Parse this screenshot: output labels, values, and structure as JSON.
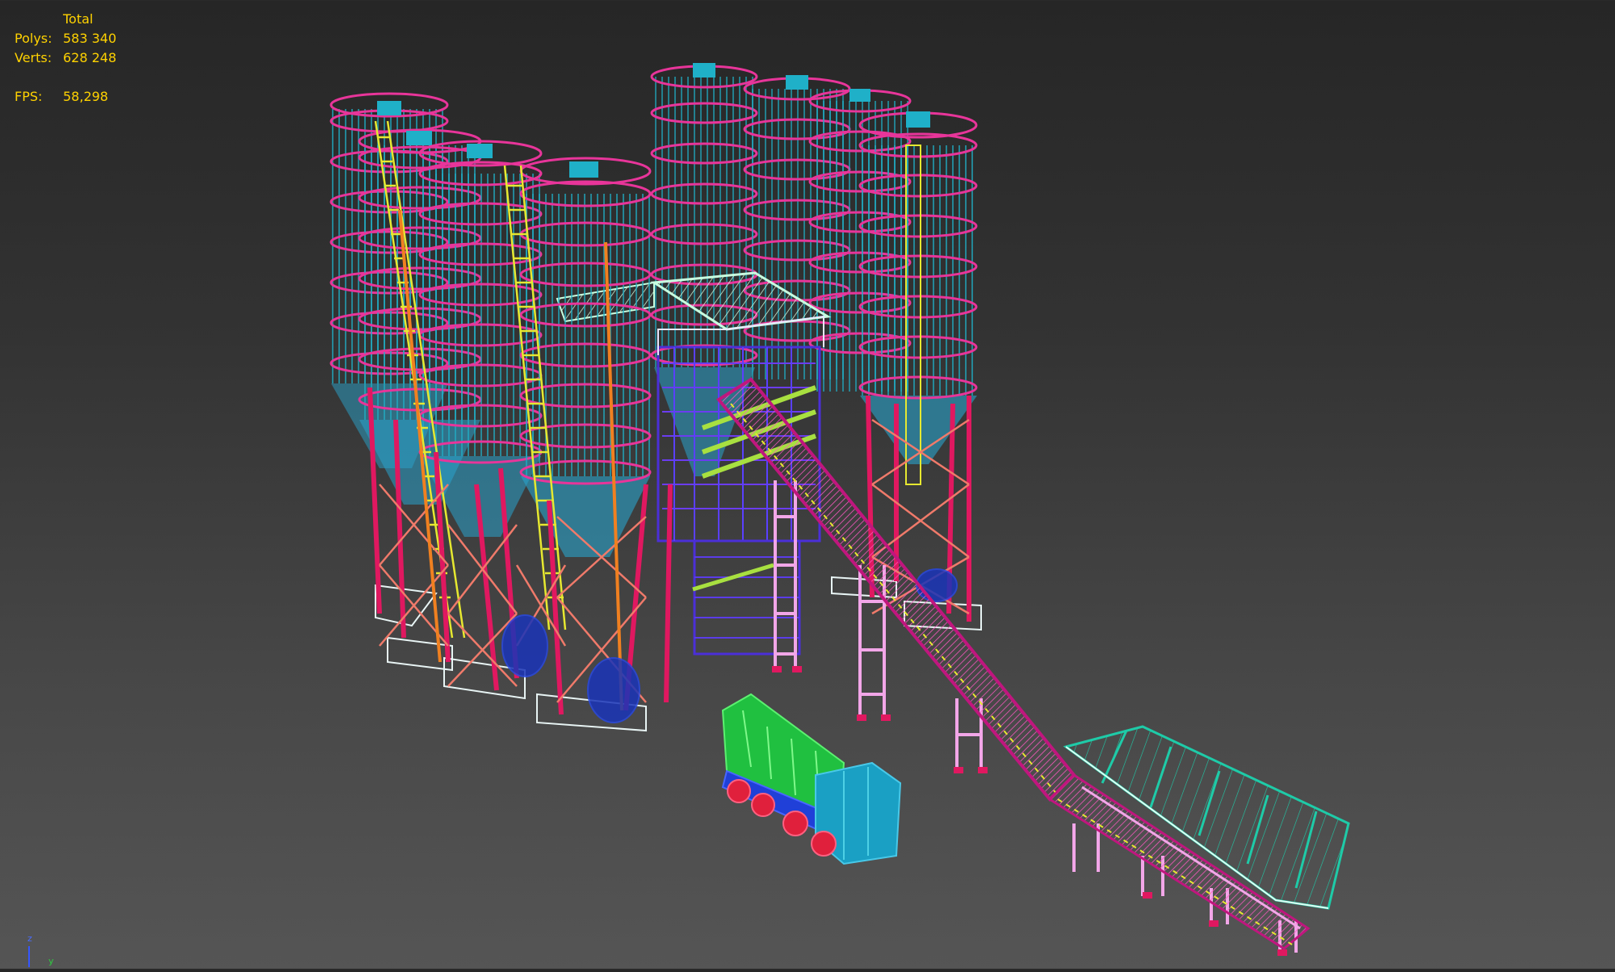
{
  "stats": {
    "header": "Total",
    "polys_label": "Polys:",
    "polys_value": "583 340",
    "verts_label": "Verts:",
    "verts_value": "628 248",
    "fps_label": "FPS:",
    "fps_value": "58,298"
  },
  "axis": {
    "z_label": "z",
    "y_label": "y"
  },
  "colors": {
    "stats_text": "#ffd200",
    "silo_body": "#1fb0c8",
    "silo_rings": "#e8359a",
    "silo_cone": "#2aa3cc",
    "legs": "#e01860",
    "bracing": "#f07a6a",
    "ladders": "#e6e830",
    "conveyor": "#c0167e",
    "conveyor_legs": "#f2a6e8",
    "hopper": "#1ecba8",
    "mixer_tower": "#4b2fd8",
    "roof": "#b9ffd9",
    "truck_cab": "#1aa0c4",
    "truck_drum": "#20c040",
    "truck_chassis": "#2040d8",
    "wheels": "#e0203c",
    "base_plates": "#e8f4f4"
  },
  "icons": [
    "axis-gizmo-icon"
  ]
}
